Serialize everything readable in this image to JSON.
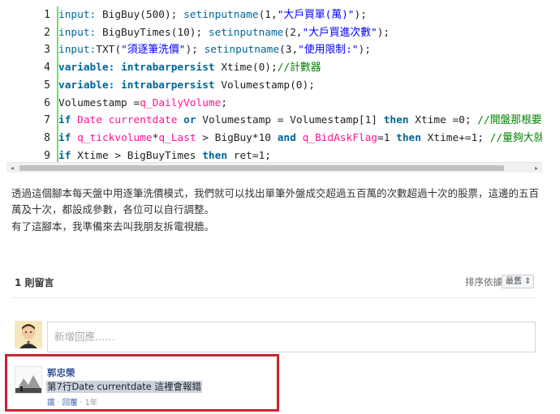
{
  "code": {
    "lines": [
      {
        "num": "1",
        "parts": [
          {
            "t": "input:",
            "c": "kw-plain"
          },
          {
            "t": " BigBuy(500); ",
            "c": ""
          },
          {
            "t": "setinputname",
            "c": "kw-plain"
          },
          {
            "t": "(1,",
            "c": ""
          },
          {
            "t": "\"大戶買單(萬)\"",
            "c": "str"
          },
          {
            "t": ");",
            "c": ""
          }
        ]
      },
      {
        "num": "2",
        "parts": [
          {
            "t": "input:",
            "c": "kw-plain"
          },
          {
            "t": " BigBuyTimes(10); ",
            "c": ""
          },
          {
            "t": "setinputname",
            "c": "kw-plain"
          },
          {
            "t": "(2,",
            "c": ""
          },
          {
            "t": "\"大戶買進次數\"",
            "c": "str"
          },
          {
            "t": ");",
            "c": ""
          }
        ]
      },
      {
        "num": "3",
        "parts": [
          {
            "t": "input:",
            "c": "kw-plain"
          },
          {
            "t": "TXT(",
            "c": ""
          },
          {
            "t": "\"須逐筆洗價\"",
            "c": "str"
          },
          {
            "t": "); ",
            "c": ""
          },
          {
            "t": "setinputname",
            "c": "kw-plain"
          },
          {
            "t": "(3,",
            "c": ""
          },
          {
            "t": "\"使用限制:\"",
            "c": "str"
          },
          {
            "t": ");",
            "c": ""
          }
        ]
      },
      {
        "num": "4",
        "parts": [
          {
            "t": "variable:",
            "c": "kw"
          },
          {
            "t": " ",
            "c": ""
          },
          {
            "t": "intrabarpersist",
            "c": "kw"
          },
          {
            "t": " Xtime(0);",
            "c": ""
          },
          {
            "t": "//計數器",
            "c": "cmt"
          }
        ]
      },
      {
        "num": "5",
        "parts": [
          {
            "t": "variable:",
            "c": "kw"
          },
          {
            "t": " ",
            "c": ""
          },
          {
            "t": "intrabarpersist",
            "c": "kw"
          },
          {
            "t": " Volumestamp(0);",
            "c": ""
          }
        ]
      },
      {
        "num": "6",
        "parts": [
          {
            "t": "Volumestamp =",
            "c": ""
          },
          {
            "t": "q_DailyVolume",
            "c": "fn"
          },
          {
            "t": ";",
            "c": ""
          }
        ]
      },
      {
        "num": "7",
        "parts": [
          {
            "t": "if",
            "c": "kw"
          },
          {
            "t": " ",
            "c": ""
          },
          {
            "t": "Date",
            "c": "fn"
          },
          {
            "t": " ",
            "c": ""
          },
          {
            "t": "currentdate",
            "c": "fn"
          },
          {
            "t": " ",
            "c": ""
          },
          {
            "t": "or",
            "c": "kw"
          },
          {
            "t": " Volumestamp = Volumestamp[1] ",
            "c": ""
          },
          {
            "t": "then",
            "c": "kw"
          },
          {
            "t": " Xtime =0; ",
            "c": ""
          },
          {
            "t": "//開盤那根要歸零",
            "c": "cmt"
          }
        ]
      },
      {
        "num": "8",
        "parts": [
          {
            "t": "if",
            "c": "kw"
          },
          {
            "t": " ",
            "c": ""
          },
          {
            "t": "q_tickvolume",
            "c": "fn"
          },
          {
            "t": "*",
            "c": ""
          },
          {
            "t": "q_Last",
            "c": "fn"
          },
          {
            "t": " > BigBuy*10 ",
            "c": ""
          },
          {
            "t": "and",
            "c": "kw"
          },
          {
            "t": " ",
            "c": ""
          },
          {
            "t": "q_BidAskFlag",
            "c": "fn"
          },
          {
            "t": "=1 ",
            "c": ""
          },
          {
            "t": "then",
            "c": "kw"
          },
          {
            "t": " Xtime+=1; ",
            "c": ""
          },
          {
            "t": "//量夠大就加一",
            "c": "cmt"
          }
        ]
      },
      {
        "num": "9",
        "parts": [
          {
            "t": "if",
            "c": "kw"
          },
          {
            "t": " Xtime > BigBuyTimes ",
            "c": ""
          },
          {
            "t": "then",
            "c": "kw"
          },
          {
            "t": " ret=1;",
            "c": ""
          }
        ]
      }
    ]
  },
  "scrollbar": {
    "left_arrow": "◂",
    "right_arrow": "▸"
  },
  "article": {
    "para1": "透過這個腳本每天盤中用逐筆洗價模式，我們就可以找出單筆外盤成交超過五百萬的次數超過十次的股票，這邊的五百萬及十次，都設成參數，各位可以自行調整。",
    "para2": "有了這腳本，我準備來去叫我朋友拆電視牆。"
  },
  "comments": {
    "count_label": "1 則留言",
    "sort_label": "排序依據",
    "sort_value": "最舊 ⇕",
    "input_placeholder": "新增回應……",
    "items": [
      {
        "author": "郭忠榮",
        "text": "第7行Date currentdate 這裡會報錯",
        "actions": [
          "讚",
          "回覆"
        ],
        "time": "1年"
      }
    ]
  },
  "colors": {
    "gutter": "#6ce26c",
    "keyword": "#006699",
    "string": "#0000ff",
    "function": "#ff1493",
    "comment": "#008200",
    "highlight": "#c8242f",
    "link": "#365899"
  }
}
